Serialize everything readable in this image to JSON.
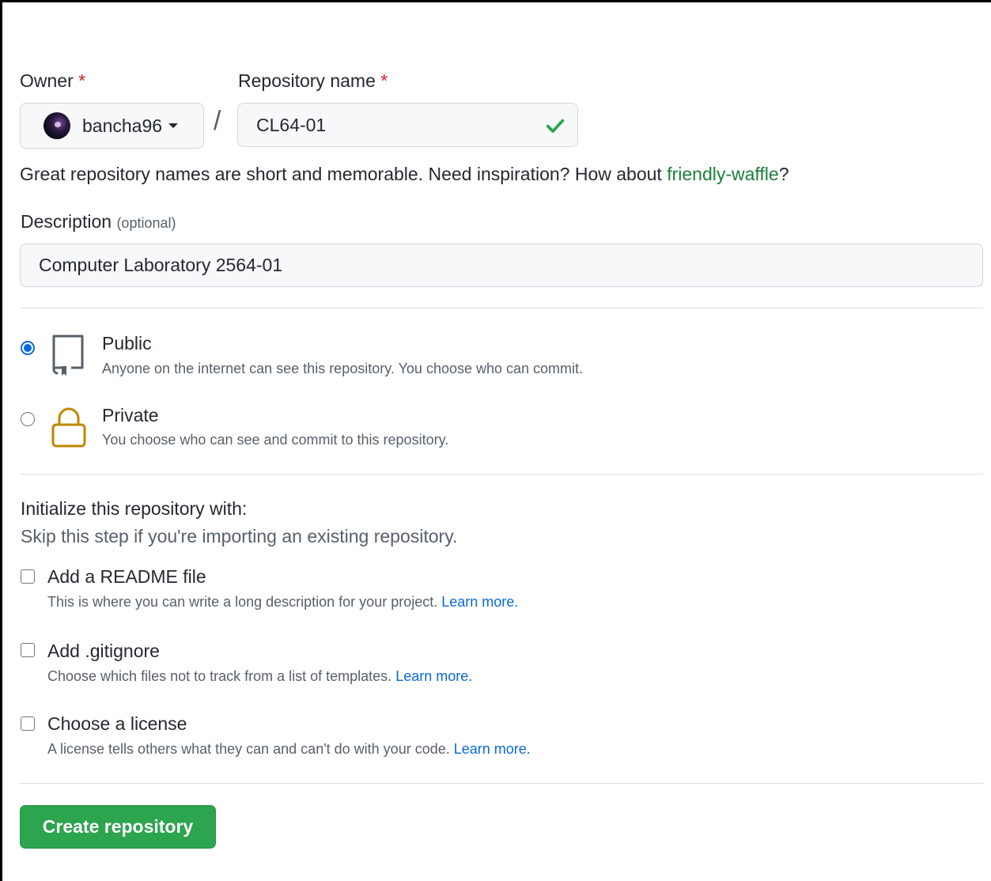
{
  "owner": {
    "label": "Owner",
    "required_mark": "*",
    "username": "bancha96"
  },
  "repository": {
    "label": "Repository name",
    "required_mark": "*",
    "separator": "/",
    "value": "CL64-01"
  },
  "name_hint": {
    "text": "Great repository names are short and memorable. Need inspiration? How about ",
    "suggestion": "friendly-waffle",
    "suffix": "?"
  },
  "description": {
    "label": "Description",
    "optional": "(optional)",
    "value": "Computer Laboratory 2564-01"
  },
  "visibility": {
    "options": [
      {
        "title": "Public",
        "description": "Anyone on the internet can see this repository. You choose who can commit.",
        "selected": true,
        "icon": "repo-icon"
      },
      {
        "title": "Private",
        "description": "You choose who can see and commit to this repository.",
        "selected": false,
        "icon": "lock-icon"
      }
    ]
  },
  "initialize": {
    "title": "Initialize this repository with:",
    "subtitle": "Skip this step if you're importing an existing repository.",
    "options": [
      {
        "title": "Add a README file",
        "description": "This is where you can write a long description for your project. ",
        "link": "Learn more."
      },
      {
        "title": "Add .gitignore",
        "description": "Choose which files not to track from a list of templates. ",
        "link": "Learn more."
      },
      {
        "title": "Choose a license",
        "description": "A license tells others what they can and can't do with your code. ",
        "link": "Learn more."
      }
    ]
  },
  "actions": {
    "create_label": "Create repository"
  },
  "colors": {
    "accent_blue": "#0969da",
    "success_green": "#2da44e",
    "suggestion_green": "#1a7f37",
    "required_red": "#cf222e",
    "lock_gold": "#bf8700"
  }
}
